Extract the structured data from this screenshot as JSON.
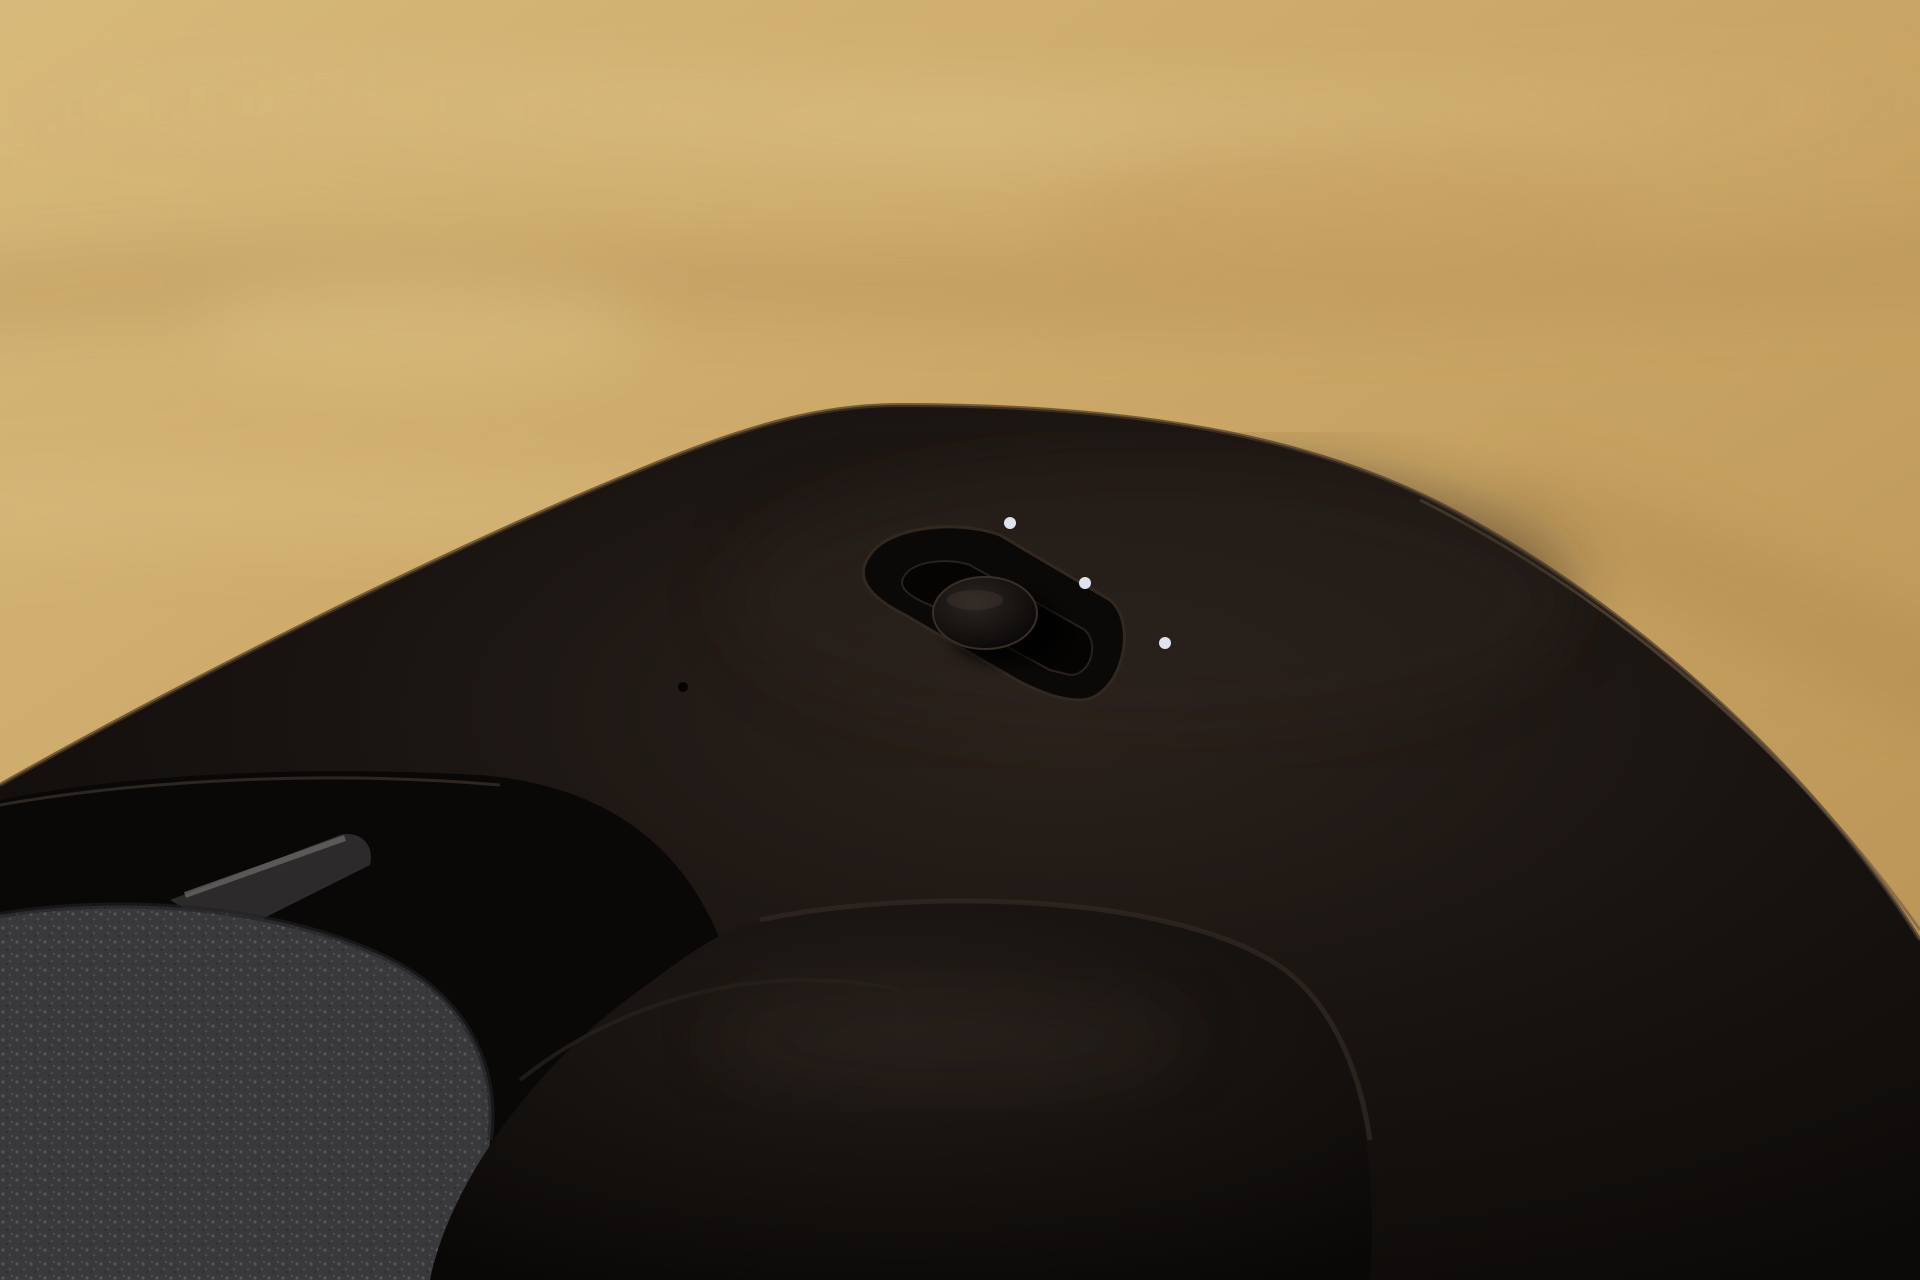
{
  "photo": {
    "subject": "headset-top-shell",
    "colors": {
      "wood_light": "#dcc081",
      "wood_mid": "#c9a465",
      "wood_dark": "#b38d52",
      "shell": "#16110e",
      "shell_highlight": "#2a211b",
      "shell_edge": "#3a2e24",
      "slider_knob": "#0f0c0a",
      "indicator_dot": "#dfe3ee",
      "fabric": "#3a3a3d",
      "fabric_speck": "#5a5a5e",
      "strap": "#0d0b0a"
    },
    "indicator_dots": {
      "count": 3
    }
  }
}
